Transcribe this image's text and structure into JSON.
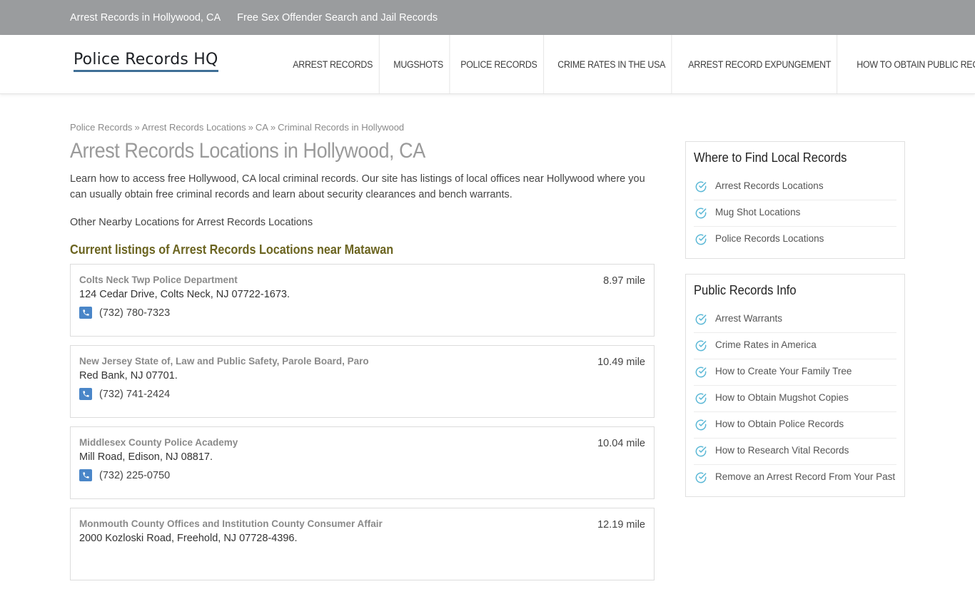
{
  "topbar": {
    "links": [
      "Arrest Records in Hollywood, CA",
      "Free Sex Offender Search and Jail Records"
    ]
  },
  "header": {
    "logo_text": "Police Records HQ",
    "nav": [
      "ARREST RECORDS",
      "MUGSHOTS",
      "POLICE RECORDS",
      "CRIME RATES IN THE USA",
      "ARREST RECORD EXPUNGEMENT",
      "HOW TO OBTAIN PUBLIC RECORDS"
    ]
  },
  "breadcrumb": {
    "items": [
      "Police Records",
      "Arrest Records Locations",
      "CA",
      "Criminal Records in Hollywood"
    ],
    "separator": "»"
  },
  "main": {
    "title": "Arrest Records Locations in Hollywood, CA",
    "intro": "Learn how to access free Hollywood, CA local criminal records. Our site has listings of local offices near Hollywood where you can usually obtain free criminal records and learn about security clearances and bench warrants.",
    "nearby": "Other Nearby Locations for Arrest Records Locations",
    "listings_heading": "Current listings of Arrest Records Locations near Matawan",
    "listings": [
      {
        "name": "Colts Neck Twp Police Department",
        "address": "124 Cedar Drive, Colts Neck, NJ 07722-1673.",
        "phone": "(732) 780-7323",
        "distance": "8.97 mile"
      },
      {
        "name": "New Jersey State of, Law and Public Safety, Parole Board, Paro",
        "address": "Red Bank, NJ 07701.",
        "phone": "(732) 741-2424",
        "distance": "10.49 mile"
      },
      {
        "name": "Middlesex County Police Academy",
        "address": "Mill Road, Edison, NJ 08817.",
        "phone": "(732) 225-0750",
        "distance": "10.04 mile"
      },
      {
        "name": "Monmouth County Offices and Institution County Consumer Affair",
        "address": "2000 Kozloski Road, Freehold, NJ 07728-4396.",
        "phone": "",
        "distance": "12.19 mile"
      }
    ]
  },
  "sidebar": {
    "local": {
      "title": "Where to Find Local Records",
      "items": [
        "Arrest Records Locations",
        "Mug Shot Locations",
        "Police Records Locations"
      ]
    },
    "info": {
      "title": "Public Records Info",
      "items": [
        "Arrest Warrants",
        "Crime Rates in America",
        "How to Create Your Family Tree",
        "How to Obtain Mugshot Copies",
        "How to Obtain Police Records",
        "How to Research Vital Records",
        "Remove an Arrest Record From Your Past"
      ]
    }
  },
  "colors": {
    "topbar_bg": "#9a9c9e",
    "logo_underline": "#3f6f96",
    "phone_icon": "#4a86c8",
    "check_icon": "#5bb8d6",
    "section_heading": "#6b6420"
  },
  "icons": {
    "phone": "phone-icon",
    "check": "check-circle-icon"
  }
}
